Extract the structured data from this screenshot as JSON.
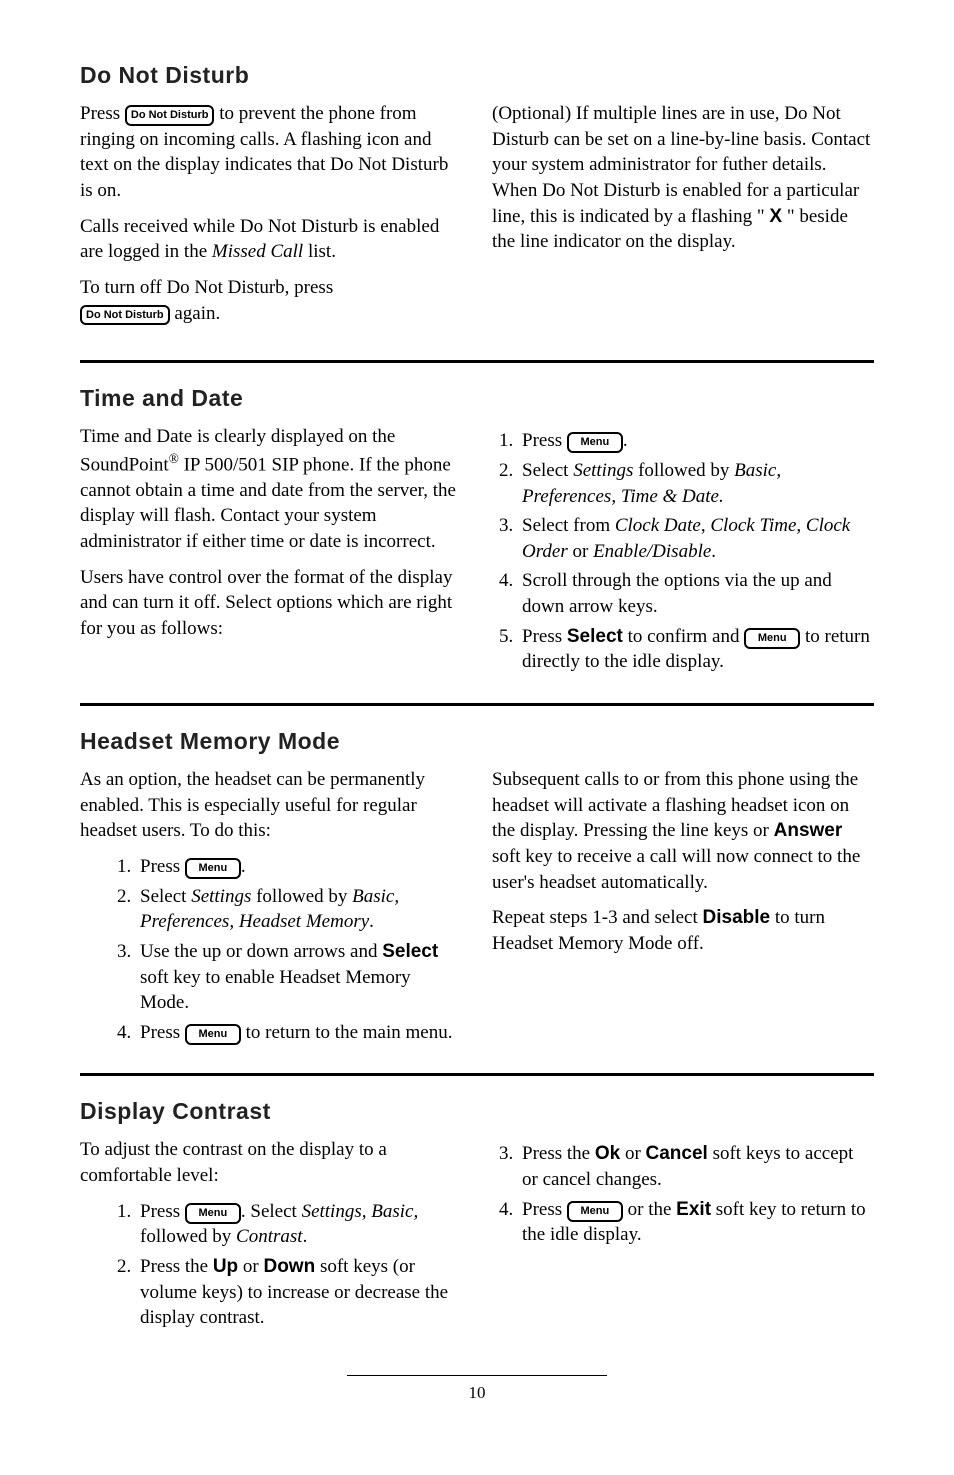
{
  "keys": {
    "do_not_disturb": "Do Not Disturb",
    "menu": "Menu"
  },
  "dnd": {
    "heading": "Do Not Disturb",
    "left": {
      "p1a": "Press ",
      "p1b": " to prevent the phone from ringing on incoming calls.  A flashing icon and text on the display indicates that Do Not Disturb is on.",
      "p2a": "Calls received while Do Not Disturb is enabled are logged in the ",
      "p2i": "Missed Call",
      "p2b": " list.",
      "p3a": "To turn off Do Not Disturb, press ",
      "p3b": " again."
    },
    "right": {
      "p1a": "(Optional) If multiple lines are in use, Do Not Disturb can be set on a line-by-line basis.  Contact your system administrator for futher details.  When Do Not Disturb is enabled for a particular line, this is indicated by a flashing \" ",
      "p1x": "X",
      "p1b": " \" beside the line indicator on the display."
    }
  },
  "time": {
    "heading": "Time and Date",
    "left": {
      "p1a": "Time and Date is clearly displayed on the SoundPoint",
      "p1sup": "®",
      "p1b": " IP 500/501 SIP phone.  If the phone cannot obtain a time and date from the server, the display will flash.  Contact your system administrator if either time or date is incorrect.",
      "p2": "Users have control over the format of the display and can turn it off.  Select options which are right for you as follows:"
    },
    "right": {
      "li1a": "Press ",
      "li1b": ".",
      "li2a": "Select ",
      "li2i1": "Settings",
      "li2b": " followed by ",
      "li2i2": "Basic, Preferences, Time & Date.",
      "li3a": "Select from ",
      "li3i1": "Clock Date",
      "li3b": ", ",
      "li3i2": "Clock Time, Clock Order",
      "li3c": " or ",
      "li3i3": "Enable/Disable",
      "li3d": ".",
      "li4": "Scroll through the options via the up and down arrow keys.",
      "li5a": "Press ",
      "li5sel": "Select",
      "li5b": " to confirm and ",
      "li5c": " to return directly to the idle display."
    }
  },
  "headset": {
    "heading": "Headset Memory Mode",
    "left": {
      "p1": "As an option, the headset can be permanently enabled.  This is especially useful for regular headset users.  To do this:",
      "li1a": "Press ",
      "li1b": ".",
      "li2a": "Select ",
      "li2i1": "Settings",
      "li2b": " followed by ",
      "li2i2": "Basic, Preferences, Headset Memory",
      "li2c": ".",
      "li3a": "Use the up or down arrows and ",
      "li3sel": "Select",
      "li3b": " soft key to enable Headset Memory Mode.",
      "li4a": "Press ",
      "li4b": " to return to the main menu."
    },
    "right": {
      "p1a": "Subsequent calls to or from this phone using the headset will activate a flashing headset icon on the display.  Pressing the line keys or ",
      "p1ans": "Answer",
      "p1b": " soft key to receive a call will now connect to the user's headset automatically.",
      "p2a": "Repeat steps 1-3 and select ",
      "p2dis": "Disable",
      "p2b": " to turn Headset Memory Mode off."
    }
  },
  "contrast": {
    "heading": "Display Contrast",
    "left": {
      "p1": "To adjust the contrast on the display to a comfortable level:",
      "li1a": "Press ",
      "li1b": ".  Select ",
      "li1i1": "Settings, Basic,",
      "li1c": " followed by ",
      "li1i2": "Contrast",
      "li1d": ".",
      "li2a": "Press the ",
      "li2up": "Up",
      "li2b": " or ",
      "li2dn": "Down",
      "li2c": " soft keys (or volume keys) to increase or decrease the display contrast."
    },
    "right": {
      "li3a": "Press the ",
      "li3ok": "Ok",
      "li3b": " or ",
      "li3cancel": "Cancel",
      "li3c": " soft keys to accept or cancel changes.",
      "li4a": "Press ",
      "li4b": " or the ",
      "li4exit": "Exit",
      "li4c": " soft key to return to the idle display."
    }
  },
  "page_number": "10"
}
